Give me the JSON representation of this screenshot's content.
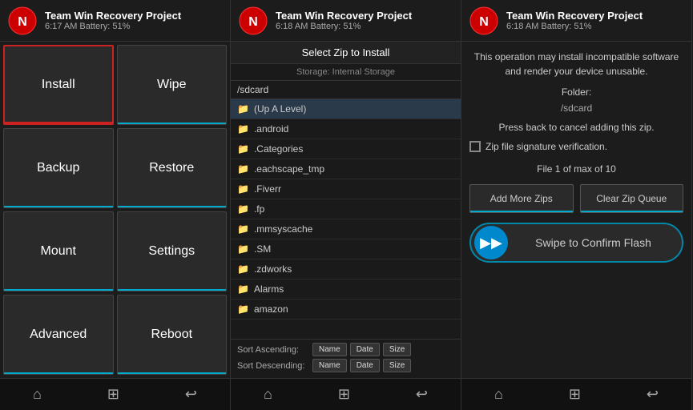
{
  "panel1": {
    "header": {
      "title": "Team Win Recovery Project",
      "status": "6:17 AM    Battery: 51%"
    },
    "buttons": [
      {
        "id": "install",
        "label": "Install",
        "highlighted": true
      },
      {
        "id": "wipe",
        "label": "Wipe",
        "highlighted": false
      },
      {
        "id": "backup",
        "label": "Backup",
        "highlighted": false
      },
      {
        "id": "restore",
        "label": "Restore",
        "highlighted": false
      },
      {
        "id": "mount",
        "label": "Mount",
        "highlighted": false
      },
      {
        "id": "settings",
        "label": "Settings",
        "highlighted": false
      },
      {
        "id": "advanced",
        "label": "Advanced",
        "highlighted": false
      },
      {
        "id": "reboot",
        "label": "Reboot",
        "highlighted": false
      }
    ],
    "nav": [
      "⌂",
      "⊞",
      "↩"
    ]
  },
  "panel2": {
    "header": {
      "title": "Team Win Recovery Project",
      "status": "6:18 AM    Battery: 51%"
    },
    "section_title": "Select Zip to Install",
    "storage_label": "Storage: Internal Storage",
    "path": "/sdcard",
    "files": [
      {
        "name": "(Up A Level)",
        "type": "folder",
        "is_up": true
      },
      {
        "name": ".android",
        "type": "folder"
      },
      {
        "name": ".Categories",
        "type": "folder"
      },
      {
        "name": ".eachscape_tmp",
        "type": "folder"
      },
      {
        "name": ".Fiverr",
        "type": "folder"
      },
      {
        "name": ".fp",
        "type": "folder"
      },
      {
        "name": ".mmsyscache",
        "type": "folder"
      },
      {
        "name": ".SM",
        "type": "folder"
      },
      {
        "name": ".zdworks",
        "type": "folder"
      },
      {
        "name": "Alarms",
        "type": "folder"
      },
      {
        "name": "amazon",
        "type": "folder"
      }
    ],
    "sort_ascending_label": "Sort Ascending:",
    "sort_descending_label": "Sort Descending:",
    "sort_buttons": [
      "Name",
      "Date",
      "Size"
    ],
    "nav": [
      "⌂",
      "⊞",
      "↩"
    ]
  },
  "panel3": {
    "header": {
      "title": "Team Win Recovery Project",
      "status": "6:18 AM    Battery: 51%"
    },
    "warning": "This operation may install incompatible\nsoftware and render your device unusable.",
    "folder_label": "Folder:",
    "folder_path": "/sdcard",
    "cancel_text": "Press back to cancel adding this zip.",
    "checkbox_label": "Zip file signature verification.",
    "file_count": "File 1 of max of 10",
    "add_more_label": "Add More Zips",
    "clear_queue_label": "Clear Zip Queue",
    "swipe_label": "Swipe to Confirm Flash",
    "nav": [
      "⌂",
      "⊞",
      "↩"
    ]
  }
}
